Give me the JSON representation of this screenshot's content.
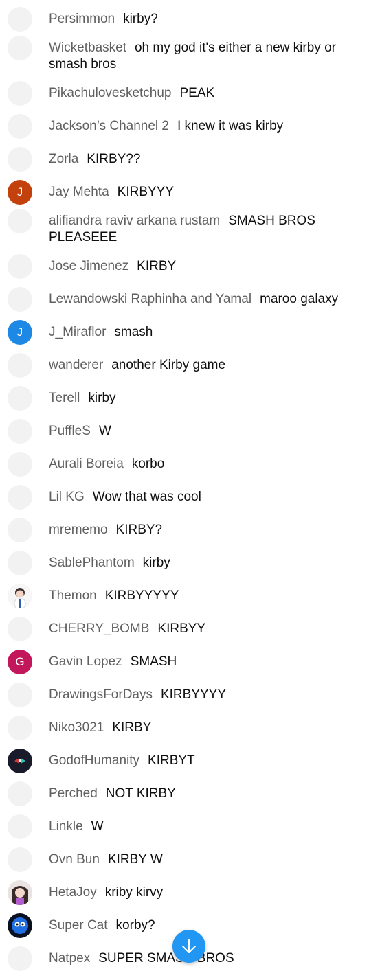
{
  "chat": {
    "messages": [
      {
        "author": "Persimmon",
        "text": "kirby?",
        "avatar": {
          "type": "placeholder"
        }
      },
      {
        "author": "Wicketbasket",
        "text": "oh my god it's either a new kirby or smash bros",
        "avatar": {
          "type": "placeholder"
        }
      },
      {
        "author": "Pikachulovesketchup",
        "text": "PEAK",
        "avatar": {
          "type": "placeholder"
        }
      },
      {
        "author": "Jackson’s Channel 2",
        "text": "I knew it was kirby",
        "avatar": {
          "type": "placeholder"
        }
      },
      {
        "author": "Zorla",
        "text": "KIRBY??",
        "avatar": {
          "type": "placeholder"
        }
      },
      {
        "author": "Jay Mehta",
        "text": "KIRBYYY",
        "avatar": {
          "type": "letter",
          "letter": "J",
          "color": "#c2410c"
        }
      },
      {
        "author": "alifiandra raviv arkana rustam",
        "text": "SMASH BROS PLEASEEE",
        "avatar": {
          "type": "placeholder"
        }
      },
      {
        "author": "Jose Jimenez",
        "text": "KIRBY",
        "avatar": {
          "type": "placeholder"
        }
      },
      {
        "author": "Lewandowski Raphinha and Yamal",
        "text": "maroo galaxy",
        "avatar": {
          "type": "placeholder"
        }
      },
      {
        "author": "J_Miraflor",
        "text": "smash",
        "avatar": {
          "type": "letter",
          "letter": "J",
          "color": "#1e88e5"
        }
      },
      {
        "author": "wanderer",
        "text": "another Kirby game",
        "avatar": {
          "type": "placeholder"
        }
      },
      {
        "author": "Terell",
        "text": "kirby",
        "avatar": {
          "type": "placeholder"
        }
      },
      {
        "author": "PuffleS",
        "text": "W",
        "avatar": {
          "type": "placeholder"
        }
      },
      {
        "author": "Aurali Boreia",
        "text": "korbo",
        "avatar": {
          "type": "placeholder"
        }
      },
      {
        "author": "Lil KG",
        "text": "Wow that was cool",
        "avatar": {
          "type": "placeholder"
        }
      },
      {
        "author": "mrememo",
        "text": "KIRBY?",
        "avatar": {
          "type": "placeholder"
        }
      },
      {
        "author": "SablePhantom",
        "text": "kirby",
        "avatar": {
          "type": "placeholder"
        }
      },
      {
        "author": "Themon",
        "text": "KIRBYYYYY",
        "avatar": {
          "type": "photo",
          "style": "person"
        }
      },
      {
        "author": "CHERRY_BOMB",
        "text": "KIRBYY",
        "avatar": {
          "type": "placeholder"
        }
      },
      {
        "author": "Gavin Lopez",
        "text": "SMASH",
        "avatar": {
          "type": "letter",
          "letter": "G",
          "color": "#c2185b"
        }
      },
      {
        "author": "DrawingsForDays",
        "text": "KIRBYYYY",
        "avatar": {
          "type": "placeholder"
        }
      },
      {
        "author": "Niko3021",
        "text": "KIRBY",
        "avatar": {
          "type": "placeholder"
        }
      },
      {
        "author": "GodofHumanity",
        "text": "KIRBYT",
        "avatar": {
          "type": "photo",
          "style": "dark"
        }
      },
      {
        "author": "Perched",
        "text": "NOT KIRBY",
        "avatar": {
          "type": "placeholder"
        }
      },
      {
        "author": "Linkle",
        "text": "W",
        "avatar": {
          "type": "placeholder"
        }
      },
      {
        "author": "Ovn Bun",
        "text": "KIRBY W",
        "avatar": {
          "type": "placeholder"
        }
      },
      {
        "author": "HetaJoy",
        "text": "kriby kirvy",
        "avatar": {
          "type": "photo",
          "style": "anime"
        }
      },
      {
        "author": "Super Cat",
        "text": "korby?",
        "avatar": {
          "type": "photo",
          "style": "blue"
        }
      },
      {
        "author": "Natpex",
        "text": "SUPER SMASH BROS",
        "avatar": {
          "type": "placeholder"
        }
      }
    ]
  },
  "scroll_button": {
    "icon": "arrow-down-icon",
    "color": "#2196f3"
  }
}
